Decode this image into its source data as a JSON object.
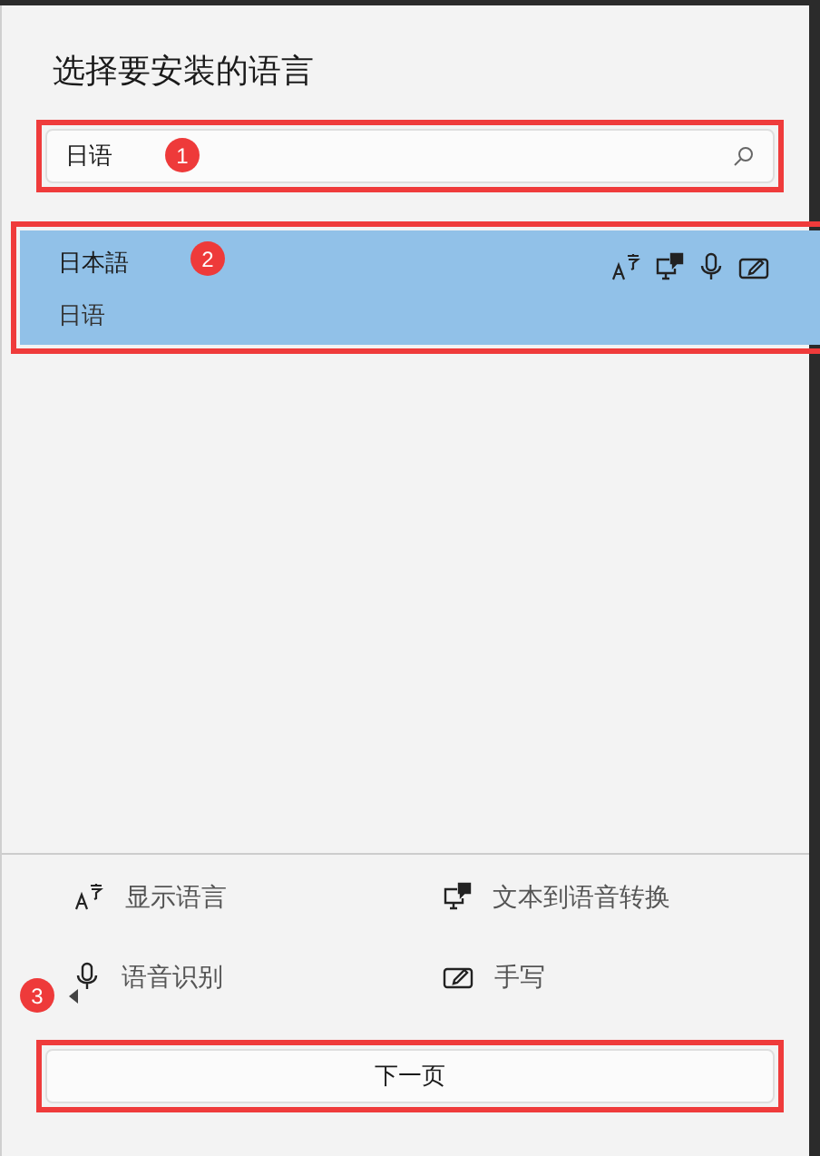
{
  "dialog": {
    "title": "选择要安装的语言"
  },
  "search": {
    "value": "日语"
  },
  "languages": [
    {
      "name": "日本語",
      "native": "日语",
      "selected": true
    }
  ],
  "features": [
    {
      "kind": "display",
      "label": "显示语言"
    },
    {
      "kind": "tts",
      "label": "文本到语音转换"
    },
    {
      "kind": "speech",
      "label": "语音识别"
    },
    {
      "kind": "handwriting",
      "label": "手写"
    }
  ],
  "next_button": {
    "label": "下一页"
  },
  "annotations": [
    "1",
    "2",
    "3"
  ]
}
